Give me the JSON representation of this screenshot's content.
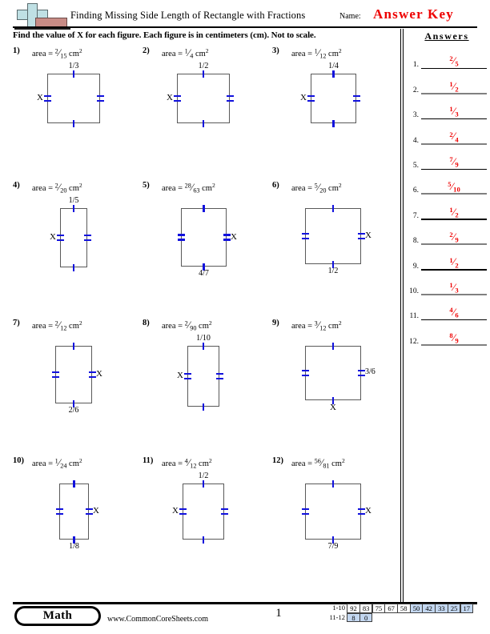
{
  "header": {
    "title": "Finding Missing Side Length of Rectangle with Fractions",
    "name_label": "Name:",
    "answer_key": "Answer Key",
    "logo_plus_color": "#bfe0e4",
    "logo_bar_color": "#c88c86"
  },
  "instructions": "Find the value of X for each figure. Each figure is in centimeters (cm). Not to scale.",
  "answers_panel": {
    "title": "Answers",
    "accent_color": "#ee0000",
    "rows": [
      {
        "num": "1.",
        "value": "2/5"
      },
      {
        "num": "2.",
        "value": "1/2"
      },
      {
        "num": "3.",
        "value": "1/3"
      },
      {
        "num": "4.",
        "value": "2/4"
      },
      {
        "num": "5.",
        "value": "7/9"
      },
      {
        "num": "6.",
        "value": "5/10"
      },
      {
        "num": "7.",
        "value": "1/2"
      },
      {
        "num": "8.",
        "value": "2/9"
      },
      {
        "num": "9.",
        "value": "1/2"
      },
      {
        "num": "10.",
        "value": "1/3"
      },
      {
        "num": "11.",
        "value": "4/6"
      },
      {
        "num": "12.",
        "value": "8/9"
      }
    ]
  },
  "problems": [
    {
      "num": "1)",
      "area_prefix": "area =",
      "area_num": "2",
      "area_den": "15",
      "units": "cm",
      "unit_sup": "2",
      "given_label": "1/3",
      "given_side": "top",
      "x_side": "left",
      "w": 66,
      "h": 62
    },
    {
      "num": "2)",
      "area_prefix": "area =",
      "area_num": "1",
      "area_den": "4",
      "units": "cm",
      "unit_sup": "2",
      "given_label": "1/2",
      "given_side": "top",
      "x_side": "left",
      "w": 66,
      "h": 62
    },
    {
      "num": "3)",
      "area_prefix": "area =",
      "area_num": "1",
      "area_den": "12",
      "units": "cm",
      "unit_sup": "2",
      "given_label": "1/4",
      "given_side": "top",
      "x_side": "left",
      "w": 57,
      "h": 62
    },
    {
      "num": "4)",
      "area_prefix": "area =",
      "area_num": "2",
      "area_den": "20",
      "units": "cm",
      "unit_sup": "2",
      "given_label": "1/5",
      "given_side": "top",
      "x_side": "left",
      "w": 34,
      "h": 74
    },
    {
      "num": "5)",
      "area_prefix": "area =",
      "area_num": "28",
      "area_den": "63",
      "units": "cm",
      "unit_sup": "2",
      "given_label": "4/7",
      "given_side": "bottom",
      "x_side": "right",
      "w": 57,
      "h": 73
    },
    {
      "num": "6)",
      "area_prefix": "area =",
      "area_num": "5",
      "area_den": "20",
      "units": "cm",
      "unit_sup": "2",
      "given_label": "1/2",
      "given_side": "bottom",
      "x_side": "right",
      "w": 70,
      "h": 70
    },
    {
      "num": "7)",
      "area_prefix": "area =",
      "area_num": "2",
      "area_den": "12",
      "units": "cm",
      "unit_sup": "2",
      "given_label": "2/6",
      "given_side": "bottom",
      "x_side": "right",
      "w": 46,
      "h": 72
    },
    {
      "num": "8)",
      "area_prefix": "area =",
      "area_num": "2",
      "area_den": "90",
      "units": "cm",
      "unit_sup": "2",
      "given_label": "1/10",
      "given_side": "top",
      "x_side": "left",
      "w": 40,
      "h": 76
    },
    {
      "num": "9)",
      "area_prefix": "area =",
      "area_num": "3",
      "area_den": "12",
      "units": "cm",
      "unit_sup": "2",
      "given_label": "3/6",
      "given_side": "right",
      "x_side": "bottom",
      "w": 70,
      "h": 68
    },
    {
      "num": "10)",
      "area_prefix": "area =",
      "area_num": "1",
      "area_den": "24",
      "units": "cm",
      "unit_sup": "2",
      "given_label": "1/8",
      "given_side": "bottom",
      "x_side": "right",
      "w": 37,
      "h": 70
    },
    {
      "num": "11)",
      "area_prefix": "area =",
      "area_num": "4",
      "area_den": "12",
      "units": "cm",
      "unit_sup": "2",
      "given_label": "1/2",
      "given_side": "top",
      "x_side": "left",
      "w": 52,
      "h": 70
    },
    {
      "num": "12)",
      "area_prefix": "area =",
      "area_num": "56",
      "area_den": "81",
      "units": "cm",
      "unit_sup": "2",
      "given_label": "7/9",
      "given_side": "bottom",
      "x_side": "right",
      "w": 70,
      "h": 70
    }
  ],
  "x_label": "X",
  "footer": {
    "subject": "Math",
    "site": "www.CommonCoreSheets.com",
    "page": "1",
    "score_rows": [
      {
        "label": "1-10",
        "cells": [
          {
            "v": "92",
            "hi": false
          },
          {
            "v": "83",
            "hi": false
          },
          {
            "v": "75",
            "hi": false
          },
          {
            "v": "67",
            "hi": false
          },
          {
            "v": "58",
            "hi": false
          },
          {
            "v": "50",
            "hi": true
          },
          {
            "v": "42",
            "hi": true
          },
          {
            "v": "33",
            "hi": true
          },
          {
            "v": "25",
            "hi": true
          },
          {
            "v": "17",
            "hi": true
          }
        ]
      },
      {
        "label": "11-12",
        "cells": [
          {
            "v": "8",
            "hi": true
          },
          {
            "v": "0",
            "hi": true
          }
        ]
      }
    ],
    "highlight_color": "#c3d7f0"
  }
}
